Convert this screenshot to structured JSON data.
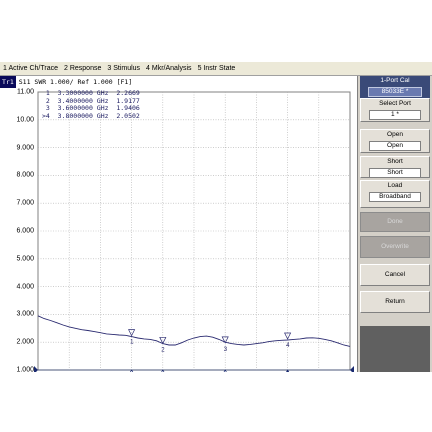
{
  "menu": [
    {
      "label": "1 Active Ch/Trace"
    },
    {
      "label": "2 Response"
    },
    {
      "label": "3 Stimulus"
    },
    {
      "label": "4 Mkr/Analysis"
    },
    {
      "label": "5 Instr State"
    }
  ],
  "trace": {
    "tag": "Tr1",
    "header": "S11  SWR 1.000/ Ref 1.000 [F1]"
  },
  "markers": [
    {
      "num": "1",
      "freq": "3.3000000 GHz",
      "value": "2.2669"
    },
    {
      "num": "2",
      "freq": "3.4000000 GHz",
      "value": "1.9177"
    },
    {
      "num": "3",
      "freq": "3.6000000 GHz",
      "value": "1.9406"
    },
    {
      "num": ">4",
      "freq": "3.8000000 GHz",
      "value": "2.0502"
    }
  ],
  "y_axis": {
    "labels": [
      "11.00",
      "10.00",
      "9.000",
      "8.000",
      "7.000",
      "6.000",
      "5.000",
      "4.000",
      "3.000",
      "2.000",
      "1.000"
    ]
  },
  "chart_data": {
    "type": "line",
    "ylim": [
      1,
      11
    ],
    "trace_color": "#2a2a70",
    "points": [
      [
        0,
        2.95
      ],
      [
        0.02,
        2.85
      ],
      [
        0.04,
        2.78
      ],
      [
        0.06,
        2.7
      ],
      [
        0.08,
        2.62
      ],
      [
        0.1,
        2.55
      ],
      [
        0.12,
        2.5
      ],
      [
        0.14,
        2.45
      ],
      [
        0.16,
        2.42
      ],
      [
        0.18,
        2.38
      ],
      [
        0.2,
        2.34
      ],
      [
        0.22,
        2.3
      ],
      [
        0.24,
        2.28
      ],
      [
        0.26,
        2.26
      ],
      [
        0.28,
        2.25
      ],
      [
        0.3,
        2.2
      ],
      [
        0.32,
        2.15
      ],
      [
        0.34,
        2.12
      ],
      [
        0.36,
        2.1
      ],
      [
        0.38,
        2.05
      ],
      [
        0.4,
        1.95
      ],
      [
        0.42,
        1.9
      ],
      [
        0.44,
        1.9
      ],
      [
        0.46,
        1.98
      ],
      [
        0.48,
        2.08
      ],
      [
        0.5,
        2.15
      ],
      [
        0.52,
        2.2
      ],
      [
        0.54,
        2.22
      ],
      [
        0.56,
        2.18
      ],
      [
        0.58,
        2.1
      ],
      [
        0.6,
        2.0
      ],
      [
        0.62,
        1.95
      ],
      [
        0.64,
        1.92
      ],
      [
        0.66,
        1.9
      ],
      [
        0.68,
        1.92
      ],
      [
        0.7,
        1.95
      ],
      [
        0.72,
        1.98
      ],
      [
        0.74,
        2.02
      ],
      [
        0.76,
        2.05
      ],
      [
        0.78,
        2.07
      ],
      [
        0.8,
        2.08
      ],
      [
        0.82,
        2.1
      ],
      [
        0.84,
        2.12
      ],
      [
        0.86,
        2.15
      ],
      [
        0.88,
        2.16
      ],
      [
        0.9,
        2.14
      ],
      [
        0.92,
        2.1
      ],
      [
        0.94,
        2.05
      ],
      [
        0.96,
        1.98
      ],
      [
        0.98,
        1.9
      ],
      [
        1.0,
        1.85
      ]
    ],
    "markers": [
      {
        "label": "1",
        "x": 0.3,
        "y": 2.2
      },
      {
        "label": "2",
        "x": 0.4,
        "y": 1.92
      },
      {
        "label": "3",
        "x": 0.6,
        "y": 1.94
      },
      {
        "label": "4",
        "x": 0.8,
        "y": 2.08
      }
    ]
  },
  "sidebar": {
    "title": "1-Port Cal",
    "kit": "85033E *",
    "keys": [
      {
        "label": "Select Port",
        "value": "1 *",
        "disabled": false
      },
      {
        "label": "Open",
        "value": "Open",
        "disabled": false
      },
      {
        "label": "Short",
        "value": "Short",
        "disabled": false
      },
      {
        "label": "Load",
        "value": "Broadband",
        "disabled": false
      },
      {
        "label": "Done",
        "value": "",
        "disabled": true
      },
      {
        "label": "Overwrite",
        "value": "",
        "disabled": true
      },
      {
        "label": "Cancel",
        "value": "",
        "disabled": false
      },
      {
        "label": "Return",
        "value": "",
        "disabled": false
      }
    ]
  }
}
